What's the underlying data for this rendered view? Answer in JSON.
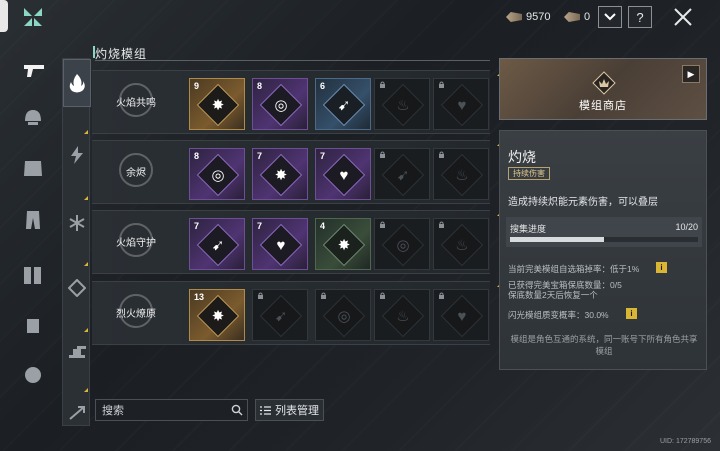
{
  "header": {
    "currency_a_value": "9570",
    "currency_b_value": "0",
    "dropdown_icon": "chevron-down-icon",
    "help_label": "?",
    "close_icon": "close-icon"
  },
  "categories": [
    {
      "name": "pistol",
      "icon": "pistol-icon"
    },
    {
      "name": "helmet",
      "icon": "helmet-icon"
    },
    {
      "name": "armor",
      "icon": "armor-icon"
    },
    {
      "name": "pants",
      "icon": "pants-icon"
    },
    {
      "name": "boots",
      "icon": "boots-icon"
    },
    {
      "name": "gloves",
      "icon": "gloves-icon"
    },
    {
      "name": "mask",
      "icon": "mask-icon"
    }
  ],
  "section": {
    "title": "灼烧模组"
  },
  "rows": [
    {
      "label": "火焰共鸣",
      "modules": [
        {
          "quality": "gold",
          "count": "9",
          "glyph": "✸"
        },
        {
          "quality": "purple",
          "count": "8",
          "glyph": "◎"
        },
        {
          "quality": "blue",
          "count": "6",
          "glyph": "➹"
        },
        {
          "quality": "locked",
          "count": "",
          "glyph": "♨"
        },
        {
          "quality": "locked",
          "count": "",
          "glyph": "♥"
        }
      ]
    },
    {
      "label": "余烬",
      "modules": [
        {
          "quality": "purple",
          "count": "8",
          "glyph": "◎"
        },
        {
          "quality": "purple",
          "count": "7",
          "glyph": "✸"
        },
        {
          "quality": "purple",
          "count": "7",
          "glyph": "♥"
        },
        {
          "quality": "locked",
          "count": "",
          "glyph": "➹"
        },
        {
          "quality": "locked",
          "count": "",
          "glyph": "♨"
        }
      ]
    },
    {
      "label": "火焰守护",
      "modules": [
        {
          "quality": "purple",
          "count": "7",
          "glyph": "➹"
        },
        {
          "quality": "purple",
          "count": "7",
          "glyph": "♥"
        },
        {
          "quality": "green",
          "count": "4",
          "glyph": "✸"
        },
        {
          "quality": "locked",
          "count": "",
          "glyph": "◎"
        },
        {
          "quality": "locked",
          "count": "",
          "glyph": "♨"
        }
      ]
    },
    {
      "label": "烈火燎原",
      "modules": [
        {
          "quality": "gold",
          "count": "13",
          "glyph": "✸"
        },
        {
          "quality": "locked",
          "count": "",
          "glyph": "➹"
        },
        {
          "quality": "locked",
          "count": "",
          "glyph": "◎"
        },
        {
          "quality": "locked",
          "count": "",
          "glyph": "♨"
        },
        {
          "quality": "locked",
          "count": "",
          "glyph": "♥"
        }
      ]
    }
  ],
  "search": {
    "placeholder": "搜索"
  },
  "list_manage": {
    "label": "列表管理"
  },
  "shop": {
    "label": "模组商店"
  },
  "info": {
    "title": "灼烧",
    "tag": "持续伤害",
    "description": "造成持续炽能元素伤害，可以叠层",
    "progress_label": "搜集进度",
    "progress_value": "10/20",
    "progress_fraction": 0.5,
    "stat1": "当前完美模组自选箱掉率：低于1%",
    "stat2": "已获得完美宝箱保底数量：0/5",
    "stat3": "保底数量2天后恢复一个",
    "stat4": "闪光模组质变概率：30.0%",
    "footer": "模组是角色互通的系统，同一账号下所有角色共享模组",
    "info_button_label": "i"
  },
  "uid": "UID: 172789756",
  "colors": {
    "accent_gold": "#d9b634",
    "accent_teal": "#8bd6c4"
  }
}
